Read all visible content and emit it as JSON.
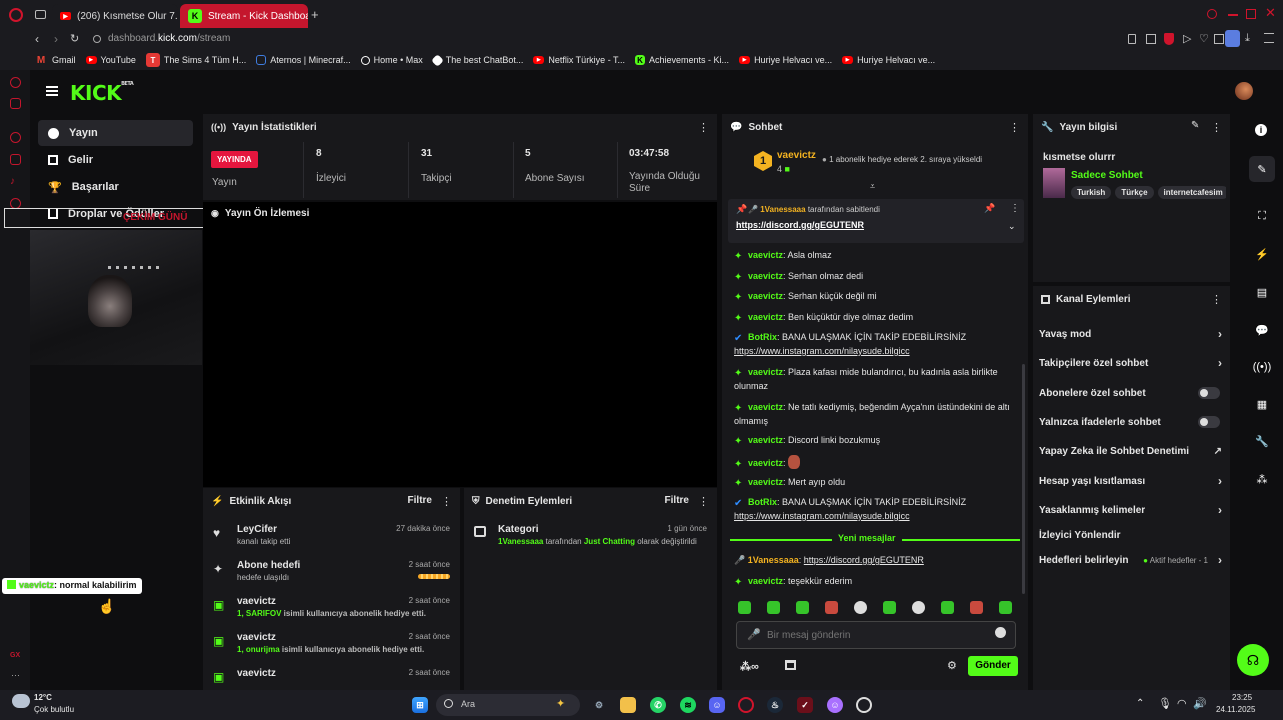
{
  "browser": {
    "tabs": [
      {
        "label": "(206) Kısmetse Olur 7. Ha",
        "icon": "youtube-icon"
      },
      {
        "label": "Stream - Kick Dashboard",
        "icon": "kick-icon"
      }
    ],
    "new_tab": "+",
    "url_domain_prefix": "dashboard.",
    "url_domain": "kick.com",
    "url_path": "/stream",
    "bookmarks": [
      {
        "label": "Gmail",
        "icon": "gmail-icon",
        "color": "#ea4335"
      },
      {
        "label": "YouTube",
        "icon": "youtube-icon",
        "color": "#ff0000"
      },
      {
        "label": "The Sims 4 Tüm H...",
        "icon": "sims-icon",
        "color": "#e53935"
      },
      {
        "label": "Aternos | Minecraf...",
        "icon": "aternos-icon",
        "color": "#3f7de0"
      },
      {
        "label": "Home • Max",
        "icon": "max-icon",
        "color": "#ffffff"
      },
      {
        "label": "The best ChatBot...",
        "icon": "chatbot-icon",
        "color": "#ffffff"
      },
      {
        "label": "Netflix Türkiye - T...",
        "icon": "youtube-icon",
        "color": "#ff0000"
      },
      {
        "label": "Achievements - Ki...",
        "icon": "kick-icon",
        "color": "#53fc18"
      },
      {
        "label": "Huriye Helvacı ve...",
        "icon": "youtube-icon",
        "color": "#ff0000"
      },
      {
        "label": "Huriye Helvacı ve...",
        "icon": "youtube-icon",
        "color": "#ff0000"
      }
    ]
  },
  "kick": {
    "logo": "KICK",
    "logo_badge": "BETA",
    "accent": "#53fc18",
    "nav": [
      {
        "label": "Yayın",
        "icon": "broadcast-icon"
      },
      {
        "label": "Gelir",
        "icon": "revenue-icon"
      },
      {
        "label": "Başarılar",
        "icon": "trophy-icon"
      },
      {
        "label": "Droplar ve Ödüller",
        "icon": "drops-icon"
      }
    ],
    "overlay_banner": "ÇEKİM GÜNÜ",
    "overlay_chat": {
      "user": "vaevictz",
      "text": ": normal kalabilirim"
    },
    "stats": {
      "title": "Yayın İstatistikleri",
      "live_badge": "YAYINDA",
      "live_label": "Yayın",
      "items": [
        {
          "value": "8",
          "label": "İzleyici"
        },
        {
          "value": "31",
          "label": "Takipçi"
        },
        {
          "value": "5",
          "label": "Abone Sayısı"
        },
        {
          "value": "03:47:58",
          "label": "Yayında Olduğu Süre"
        }
      ]
    },
    "preview_title": "Yayın Ön İzlemesi",
    "activity": {
      "title": "Etkinlik Akışı",
      "filter": "Filtre",
      "events": [
        {
          "title": "LeyCifer",
          "sub": "kanalı takip etti",
          "time": "27 dakika önce",
          "icon": "heart-icon"
        },
        {
          "title": "Abone hedefi",
          "sub": "hedefe ulaşıldı",
          "time": "2 saat önce",
          "icon": "sparkle-icon",
          "progress": 1.0
        },
        {
          "title": "vaevictz",
          "sub_highlight": "1, SARIFOV",
          "sub": " isimli kullanıcıya abonelik hediye etti.",
          "time": "2 saat önce",
          "icon": "gift-icon"
        },
        {
          "title": "vaevictz",
          "sub_highlight": "1, onurijma",
          "sub": " isimli kullanıcıya abonelik hediye etti.",
          "time": "2 saat önce",
          "icon": "gift-icon"
        },
        {
          "title": "vaevictz",
          "sub": "",
          "time": "2 saat önce",
          "icon": "gift-icon"
        }
      ]
    },
    "moderation": {
      "title": "Denetim Eylemleri",
      "filter": "Filtre",
      "items": [
        {
          "title": "Kategori",
          "time": "1 gün önce",
          "user": "1Vanessaaa",
          "mid": " tarafından ",
          "cat": "Just Chatting",
          "tail": " olarak değiştirildi",
          "icon": "category-icon"
        }
      ]
    },
    "chat": {
      "title": "Sohbet",
      "top_gifter": {
        "rank": "1",
        "user": "vaevictz",
        "count": "4",
        "text": "1 abonelik hediye ederek 2. sıraya yükseldi"
      },
      "pinned": {
        "user": "1Vanessaaa",
        "text": "tarafından sabitlendi",
        "link": "https://discord.gg/gEGUTENR"
      },
      "messages": [
        {
          "user": "vaevictz",
          "text": "Asla olmaz"
        },
        {
          "user": "vaevictz",
          "text": "Serhan olmaz dedi"
        },
        {
          "user": "vaevictz",
          "text": "Serhan küçük değil mi"
        },
        {
          "user": "vaevictz",
          "text": "Ben küçüktür diye olmaz dedim"
        },
        {
          "user": "BotRix",
          "text": "BANA ULAŞMAK İÇİN TAKİP EDEBİLİRSİNİZ",
          "link": "https://www.instagram.com/nilaysude.bilgicc",
          "bot": true
        },
        {
          "user": "vaevictz",
          "text": "Plaza kafası mide bulandırıcı, bu kadınla asla birlikte olunmaz"
        },
        {
          "user": "vaevictz",
          "text": "Ne tatlı kediymiş, beğendim Ayça'nın üstündekini de altı olmamış"
        },
        {
          "user": "vaevictz",
          "text": "Discord linki bozukmuş"
        },
        {
          "user": "vaevictz",
          "text": ""
        },
        {
          "user": "vaevictz",
          "text": "Mert ayıp oldu"
        },
        {
          "user": "BotRix",
          "text": "BANA ULAŞMAK İÇİN TAKİP EDEBİLİRSİNİZ",
          "link": "https://www.instagram.com/nilaysude.bilgicc",
          "bot": true
        }
      ],
      "new_messages_label": "Yeni mesajlar",
      "new_messages": [
        {
          "user": "1Vanessaaa",
          "link": "https://discord.gg/gEGUTENR"
        },
        {
          "user": "vaevictz",
          "text": "teşekkür ederim"
        }
      ],
      "input_placeholder": "Bir mesaj gönderin",
      "send": "Gönder"
    },
    "stream_info": {
      "title": "Yayın bilgisi",
      "stream_title": "kısmetse olurrr",
      "category": "Sadece Sohbet",
      "tags": [
        "Turkish",
        "Türkçe",
        "internetcafesim"
      ]
    },
    "channel_actions": {
      "title": "Kanal Eylemleri",
      "rows": [
        {
          "label": "Yavaş mod",
          "type": "chevron"
        },
        {
          "label": "Takipçilere özel sohbet",
          "type": "chevron"
        },
        {
          "label": "Abonelere özel sohbet",
          "type": "toggle"
        },
        {
          "label": "Yalnızca ifadelerle sohbet",
          "type": "toggle"
        },
        {
          "label": "Yapay Zeka ile Sohbet Denetimi",
          "type": "external"
        },
        {
          "label": "Hesap yaşı kısıtlaması",
          "type": "chevron"
        },
        {
          "label": "Yasaklanmış kelimeler",
          "type": "chevron"
        },
        {
          "label": "İzleyici Yönlendir",
          "type": "none"
        },
        {
          "label": "Hedefleri belirleyin",
          "type": "chevron",
          "extra": "Aktif hedefler - 1"
        }
      ]
    }
  },
  "taskbar": {
    "weather_temp": "12°C",
    "weather_text": "Çok bulutlu",
    "search": "Ara",
    "time": "23:25",
    "date": "24.11.2025"
  }
}
